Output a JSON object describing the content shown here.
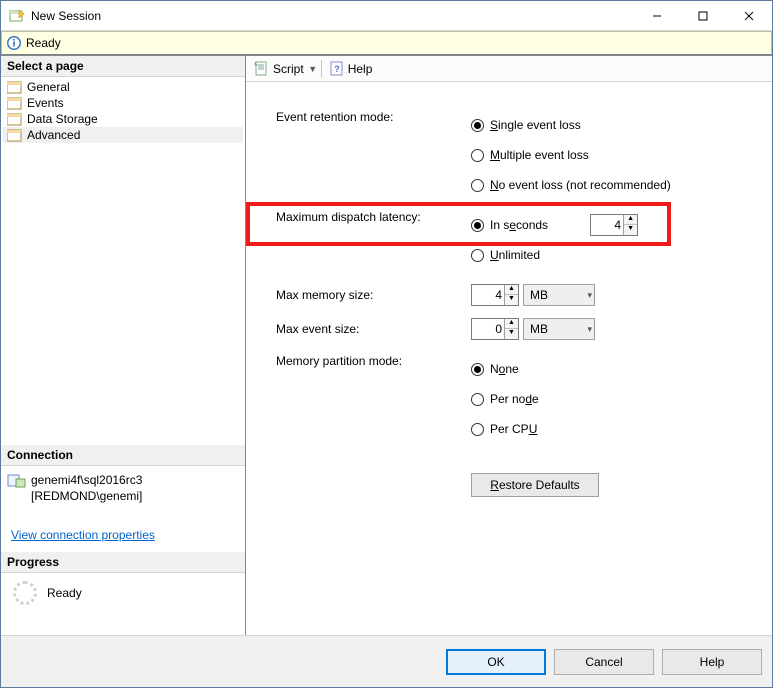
{
  "window": {
    "title": "New Session"
  },
  "readybar": {
    "text": "Ready"
  },
  "sidebar": {
    "select_page_header": "Select a page",
    "pages": [
      "General",
      "Events",
      "Data Storage",
      "Advanced"
    ],
    "selected_index": 3,
    "connection_header": "Connection",
    "connection_line1": "genemi4f\\sql2016rc3",
    "connection_line2": "[REDMOND\\genemi]",
    "view_connection_link": "View connection properties",
    "progress_header": "Progress",
    "progress_text": "Ready"
  },
  "toolbar": {
    "script_label": "Script",
    "help_label": "Help"
  },
  "form": {
    "event_retention_label": "Event retention mode:",
    "retention_options": {
      "single": {
        "pre": "",
        "key": "S",
        "post": "ingle event loss"
      },
      "multiple": {
        "pre": "",
        "key": "M",
        "post": "ultiple event loss"
      },
      "none": {
        "pre": "",
        "key": "N",
        "post": "o event loss (not recommended)"
      }
    },
    "max_dispatch_label": "Maximum dispatch latency:",
    "dispatch_options": {
      "seconds": {
        "pre": "In s",
        "key": "e",
        "post": "conds"
      },
      "unlimited": {
        "pre": "",
        "key": "U",
        "post": "nlimited"
      }
    },
    "dispatch_seconds_value": "4",
    "max_memory_label": "Max memory size:",
    "max_memory_value": "4",
    "max_memory_unit": "MB",
    "max_event_label": "Max event size:",
    "max_event_value": "0",
    "max_event_unit": "MB",
    "partition_label": "Memory partition mode:",
    "partition_options": {
      "none": {
        "pre": "N",
        "key": "o",
        "post": "ne"
      },
      "pernode": {
        "pre": "Per no",
        "key": "d",
        "post": "e"
      },
      "percpu": {
        "pre": "Per CP",
        "key": "U",
        "post": ""
      }
    },
    "restore_label_pre": "",
    "restore_label_key": "R",
    "restore_label_post": "estore Defaults"
  },
  "footer": {
    "ok": "OK",
    "cancel": "Cancel",
    "help": "Help"
  }
}
